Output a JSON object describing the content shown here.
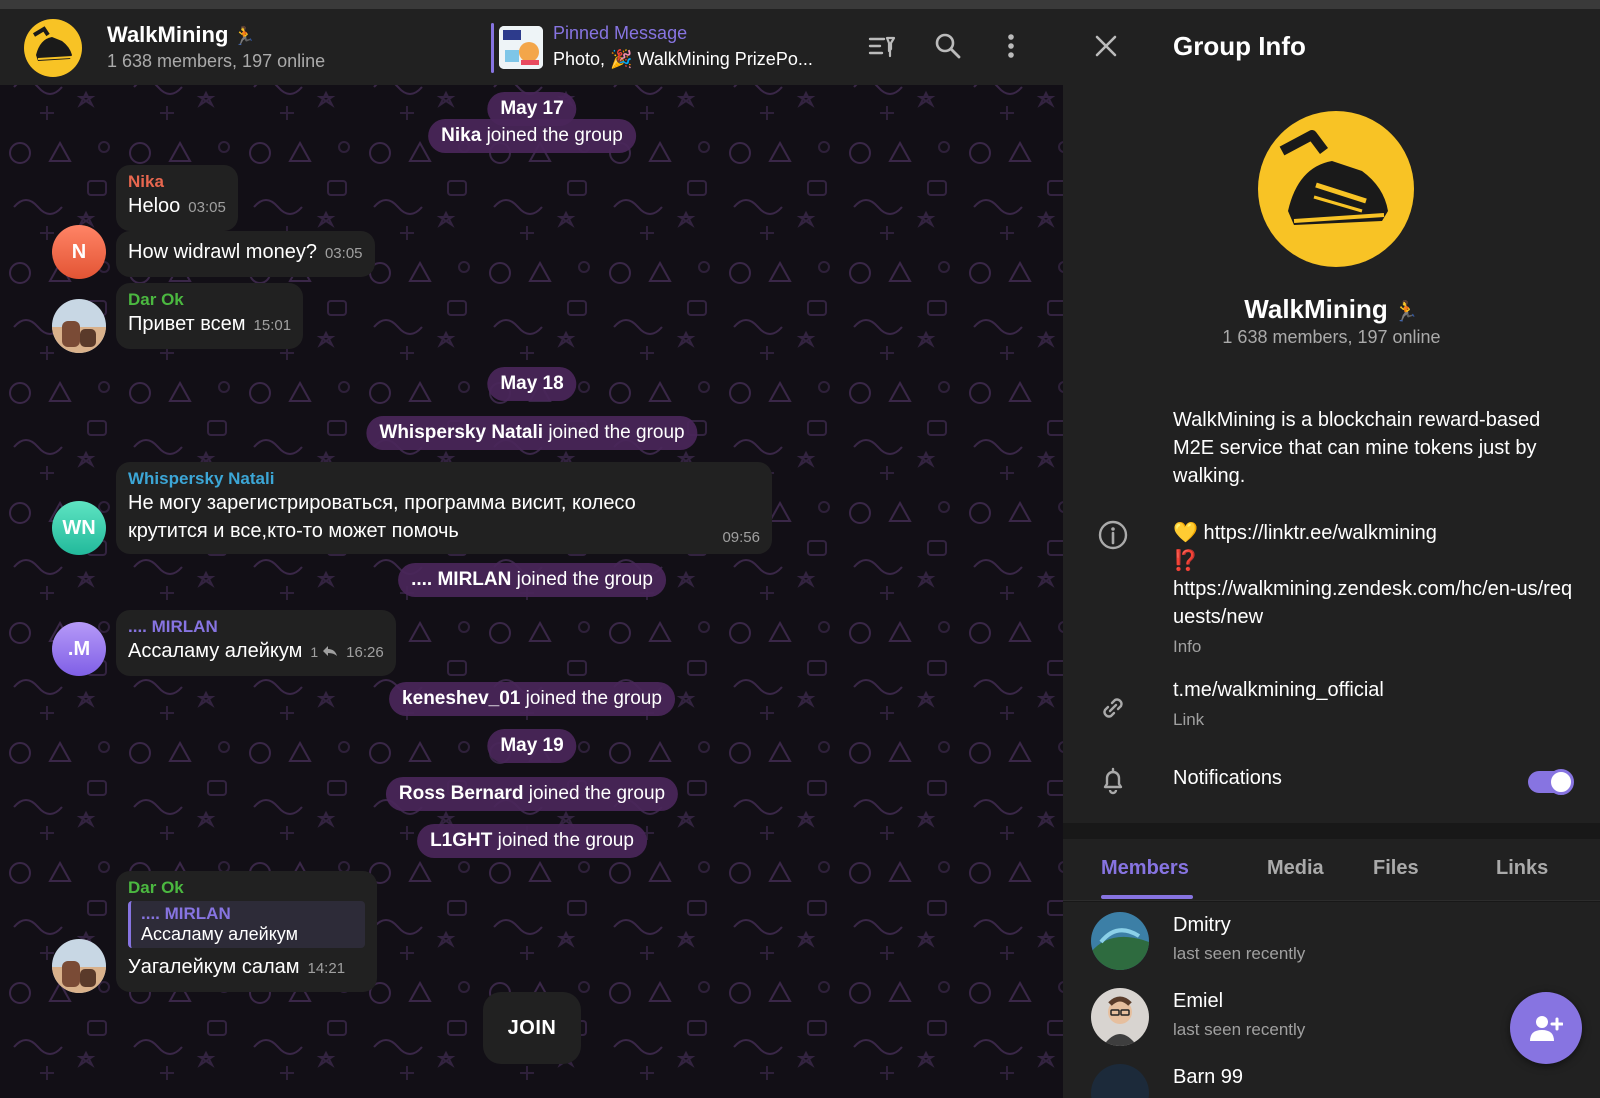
{
  "chat": {
    "title": "WalkMining",
    "title_emoji": "🏃",
    "subtitle": "1 638 members, 197 online",
    "pinned_label": "Pinned Message",
    "pinned_text": "Photo, 🎉 WalkMining PrizePo...",
    "header_icons": [
      "filter-icon",
      "search-icon",
      "more-icon"
    ],
    "join_label": "JOIN"
  },
  "service": {
    "d1": "May 17",
    "e1_name": "Nika",
    "e1_rest": " joined the group",
    "d2": "May 18",
    "e2_name": "Whispersky Natali",
    "e2_rest": " joined the group",
    "e3_name": ".... MIRLAN",
    "e3_rest": " joined the group",
    "e4_name": "keneshev_01",
    "e4_rest": " joined the group",
    "d3": "May 19",
    "e5_name": "Ross Bernard",
    "e5_rest": " joined the group",
    "e6_name": "L1GHT",
    "e6_rest": " joined the group"
  },
  "messages": {
    "m1": {
      "name": "Nika",
      "text": "Heloo",
      "time": "03:05",
      "color": "#e8674f"
    },
    "m2": {
      "text": "How widrawl money?",
      "time": "03:05",
      "avatar": "N"
    },
    "m3": {
      "name": "Dar Ok",
      "text": "Привет всем",
      "time": "15:01",
      "color": "#4bb840"
    },
    "m4": {
      "name": "Whispersky Natali",
      "text": "Не могу зарегистрироваться, программа висит, колесо крутится и все,кто-то может помочь",
      "time": "09:56",
      "color": "#3ca6d6",
      "avatar": "WN"
    },
    "m5": {
      "name": ".... MIRLAN",
      "text": "Ассаламу алейкум",
      "replies": "1",
      "time": "16:26",
      "color": "#8774e1",
      "avatar": ".M"
    },
    "m6": {
      "name": "Dar Ok",
      "reply_name": ".... MIRLAN",
      "reply_text": "Ассаламу алейкум",
      "text": "Уагалейкум салам",
      "time": "14:21",
      "color": "#4bb840"
    }
  },
  "panel": {
    "title": "Group Info",
    "name": "WalkMining",
    "name_emoji": "🏃",
    "subtitle": "1 638 members, 197 online",
    "description": "WalkMining is a blockchain reward-based M2E service that can mine tokens just by walking.",
    "link1_emoji": "💛",
    "link1": "https://linktr.ee/walkmining",
    "link2_emoji": "⁉️",
    "link2": "https://walkmining.zendesk.com/hc/en-us/requests/new",
    "info_caption": "Info",
    "tlink": "t.me/walkmining_official",
    "tlink_caption": "Link",
    "notifications": "Notifications",
    "notifications_on": true,
    "tabs": [
      "Members",
      "Media",
      "Files",
      "Links"
    ],
    "members": [
      {
        "name": "Dmitry",
        "status": "last seen recently"
      },
      {
        "name": "Emiel",
        "status": "last seen recently"
      },
      {
        "name": "Barn 99",
        "status": ""
      }
    ]
  },
  "colors": {
    "accent": "#8774e1",
    "brand_yellow": "#f8c325",
    "panel_bg": "#212121"
  }
}
